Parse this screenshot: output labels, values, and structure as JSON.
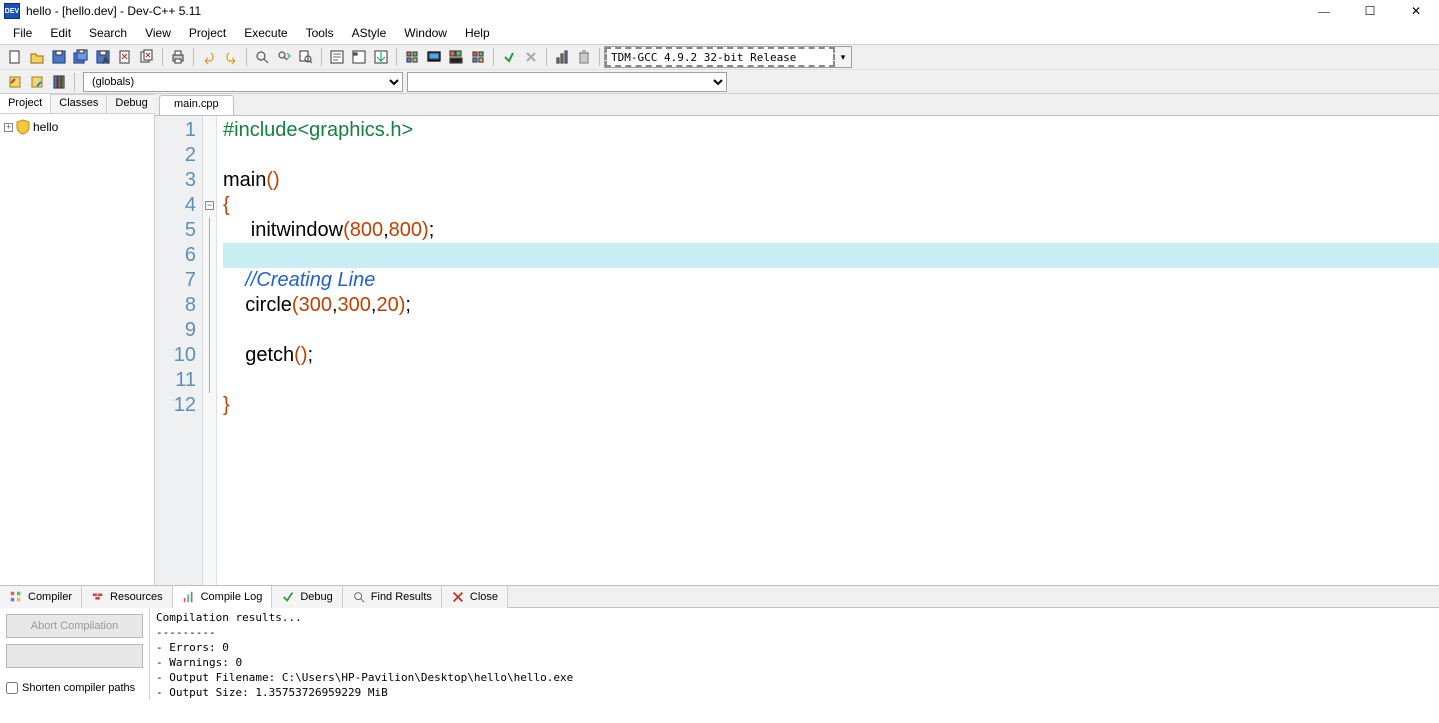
{
  "window": {
    "title": "hello - [hello.dev] - Dev-C++ 5.11"
  },
  "menu": [
    "File",
    "Edit",
    "Search",
    "View",
    "Project",
    "Execute",
    "Tools",
    "AStyle",
    "Window",
    "Help"
  ],
  "toolbar": {
    "globals_label": "(globals)",
    "compiler_profile": "TDM-GCC 4.9.2 32-bit Release"
  },
  "sidebar": {
    "tabs": [
      "Project",
      "Classes",
      "Debug"
    ],
    "project_name": "hello"
  },
  "editor": {
    "tab": "main.cpp",
    "lines": {
      "count": 12,
      "highlighted": 6,
      "tokens": {
        "l1a": "#include<graphics.h>",
        "l3a": "main",
        "l3b": "()",
        "l4a": "{",
        "l5a": "initwindow",
        "l5b": "(",
        "l5c": "800",
        "l5d": ",",
        "l5e": "800",
        "l5f": ")",
        "l5g": ";",
        "l7a": "//Creating Line",
        "l8a": "circle",
        "l8b": "(",
        "l8c": "300",
        "l8d": ",",
        "l8e": "300",
        "l8f": ",",
        "l8g": "20",
        "l8h": ")",
        "l8i": ";",
        "l10a": "getch",
        "l10b": "()",
        "l10c": ";",
        "l12a": "}"
      }
    }
  },
  "bottom": {
    "tabs": [
      "Compiler",
      "Resources",
      "Compile Log",
      "Debug",
      "Find Results",
      "Close"
    ],
    "abort_label": "Abort Compilation",
    "shorten_label": "Shorten compiler paths",
    "log": "Compilation results...\n---------\n- Errors: 0\n- Warnings: 0\n- Output Filename: C:\\Users\\HP-Pavilion\\Desktop\\hello\\hello.exe\n- Output Size: 1.35753726959229 MiB"
  }
}
